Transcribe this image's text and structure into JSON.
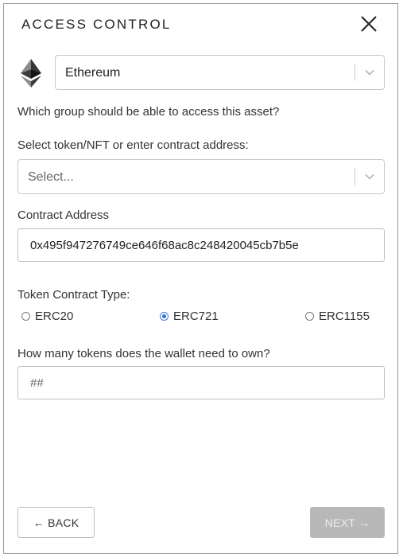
{
  "header": {
    "title": "ACCESS CONTROL",
    "close_icon": "close-icon"
  },
  "chain_select": {
    "icon": "ethereum-icon",
    "selected": "Ethereum"
  },
  "question": "Which group should be able to access this asset?",
  "token_select": {
    "label": "Select token/NFT or enter contract address:",
    "placeholder": "Select..."
  },
  "contract_address": {
    "label": "Contract Address",
    "value": "0x495f947276749ce646f68ac8c248420045cb7b5e"
  },
  "token_type": {
    "label": "Token Contract Type:",
    "options": [
      {
        "label": "ERC20",
        "checked": false
      },
      {
        "label": "ERC721",
        "checked": true
      },
      {
        "label": "ERC1155",
        "checked": false
      }
    ]
  },
  "token_amount": {
    "label": "How many tokens does the wallet need to own?",
    "placeholder": "##"
  },
  "footer": {
    "back_label": "← BACK",
    "next_label": "NEXT →"
  },
  "colors": {
    "radio_accent": "#2f6fd6",
    "next_disabled_bg": "#b8b8b8"
  }
}
